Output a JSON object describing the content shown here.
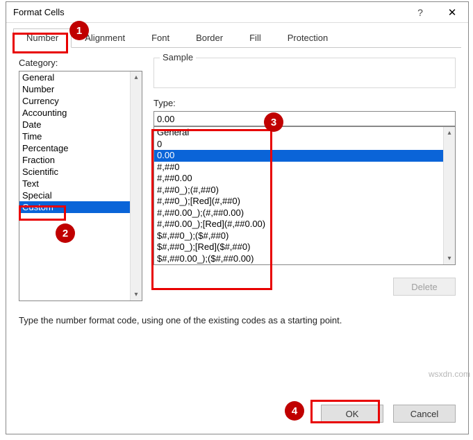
{
  "titlebar": {
    "title": "Format Cells",
    "help": "?",
    "close": "✕"
  },
  "tabs": [
    "Number",
    "Alignment",
    "Font",
    "Border",
    "Fill",
    "Protection"
  ],
  "active_tab": 0,
  "category": {
    "label": "Category:",
    "items": [
      "General",
      "Number",
      "Currency",
      "Accounting",
      "Date",
      "Time",
      "Percentage",
      "Fraction",
      "Scientific",
      "Text",
      "Special",
      "Custom"
    ],
    "selected_index": 11
  },
  "sample": {
    "label": "Sample"
  },
  "type": {
    "label": "Type:",
    "value": "0.00",
    "items": [
      "General",
      "0",
      "0.00",
      "#,##0",
      "#,##0.00",
      "#,##0_);(#,##0)",
      "#,##0_);[Red](#,##0)",
      "#,##0.00_);(#,##0.00)",
      "#,##0.00_);[Red](#,##0.00)",
      "$#,##0_);($#,##0)",
      "$#,##0_);[Red]($#,##0)",
      "$#,##0.00_);($#,##0.00)"
    ],
    "selected_index": 2
  },
  "buttons": {
    "delete": "Delete",
    "ok": "OK",
    "cancel": "Cancel"
  },
  "hint": "Type the number format code, using one of the existing codes as a starting point.",
  "badges": [
    "1",
    "2",
    "3",
    "4"
  ],
  "watermark": "wsxdn.com"
}
